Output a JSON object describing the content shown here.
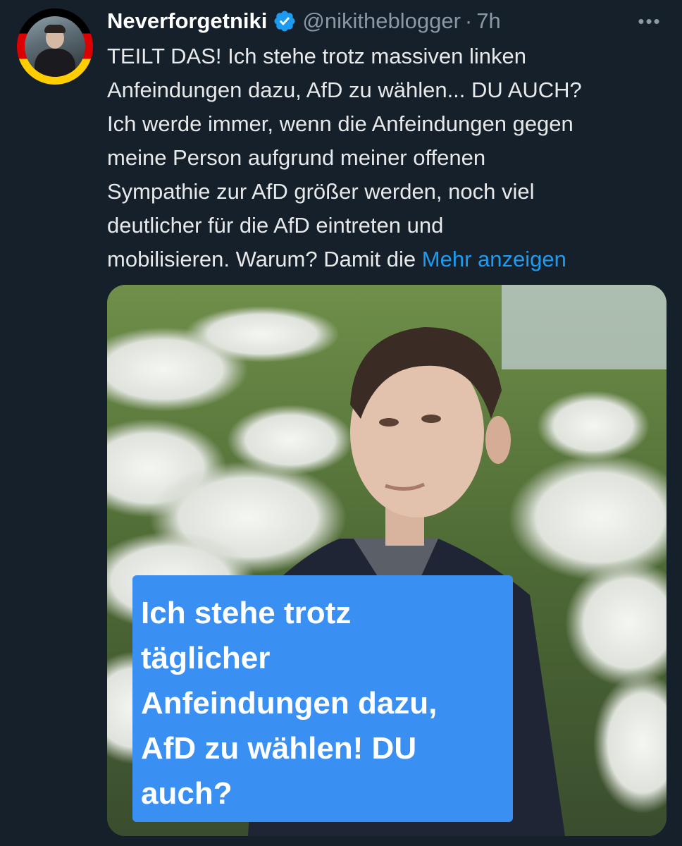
{
  "tweet": {
    "display_name": "Neverforgetniki",
    "handle": "@nikitheblogger",
    "separator": "·",
    "time": "7h",
    "more_icon": "more-icon",
    "text_lines": [
      "TEILT DAS! Ich stehe trotz massiven linken",
      "Anfeindungen dazu, AfD zu wählen... DU AUCH?",
      "Ich werde immer, wenn die Anfeindungen gegen",
      "meine Person aufgrund meiner offenen",
      "Sympathie zur AfD größer werden, noch viel",
      "deutlicher für die AfD eintreten und",
      "mobilisieren. Warum? Damit die"
    ],
    "show_more": "Mehr anzeigen",
    "media": {
      "overlay_lines": [
        "Ich stehe trotz",
        "täglicher",
        "Anfeindungen dazu,",
        "AfD zu wählen! DU",
        "auch?"
      ],
      "overlay_color": "#3a8ff2"
    },
    "colors": {
      "background": "#15202b",
      "text": "#e7e9ea",
      "secondary": "#8b98a5",
      "link": "#1d9bf0",
      "verified": "#1d9bf0"
    }
  }
}
